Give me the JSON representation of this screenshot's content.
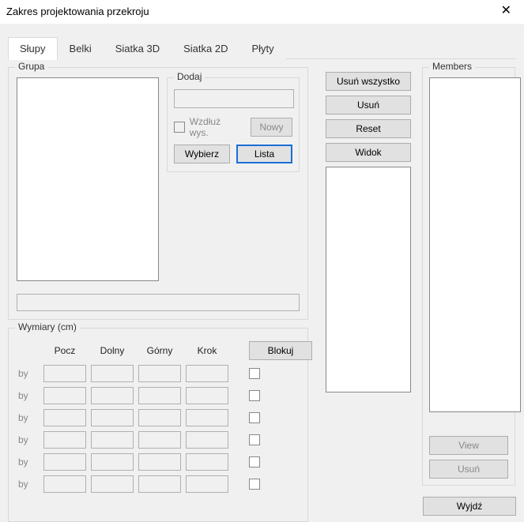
{
  "window": {
    "title": "Zakres projektowania przekroju",
    "close_icon": "✕"
  },
  "tabs": [
    {
      "label": "Słupy",
      "active": true
    },
    {
      "label": "Belki",
      "active": false
    },
    {
      "label": "Siatka 3D",
      "active": false
    },
    {
      "label": "Siatka 2D",
      "active": false
    },
    {
      "label": "Płyty",
      "active": false
    }
  ],
  "group": {
    "legend": "Grupa"
  },
  "add": {
    "legend": "Dodaj",
    "along_height_label": "Wzdłuż wys.",
    "new_btn": "Nowy",
    "select_btn": "Wybierz",
    "list_btn": "Lista"
  },
  "actions": {
    "remove_all": "Usuń wszystko",
    "remove": "Usuń",
    "reset": "Reset",
    "view": "Widok"
  },
  "members": {
    "legend": "Members",
    "view_btn": "View",
    "remove_btn": "Usuń"
  },
  "dimensions": {
    "legend": "Wymiary (cm)",
    "headers": {
      "pocz": "Pocz",
      "dolny": "Dolny",
      "gorny": "Górny",
      "krok": "Krok"
    },
    "lock_btn": "Blokuj",
    "row_label": "by",
    "rows": [
      {
        "pocz": "",
        "dolny": "",
        "gorny": "",
        "krok": "",
        "chk": false
      },
      {
        "pocz": "",
        "dolny": "",
        "gorny": "",
        "krok": "",
        "chk": false
      },
      {
        "pocz": "",
        "dolny": "",
        "gorny": "",
        "krok": "",
        "chk": false
      },
      {
        "pocz": "",
        "dolny": "",
        "gorny": "",
        "krok": "",
        "chk": false
      },
      {
        "pocz": "",
        "dolny": "",
        "gorny": "",
        "krok": "",
        "chk": false
      },
      {
        "pocz": "",
        "dolny": "",
        "gorny": "",
        "krok": "",
        "chk": false
      }
    ]
  },
  "exit": {
    "label": "Wyjdź"
  }
}
